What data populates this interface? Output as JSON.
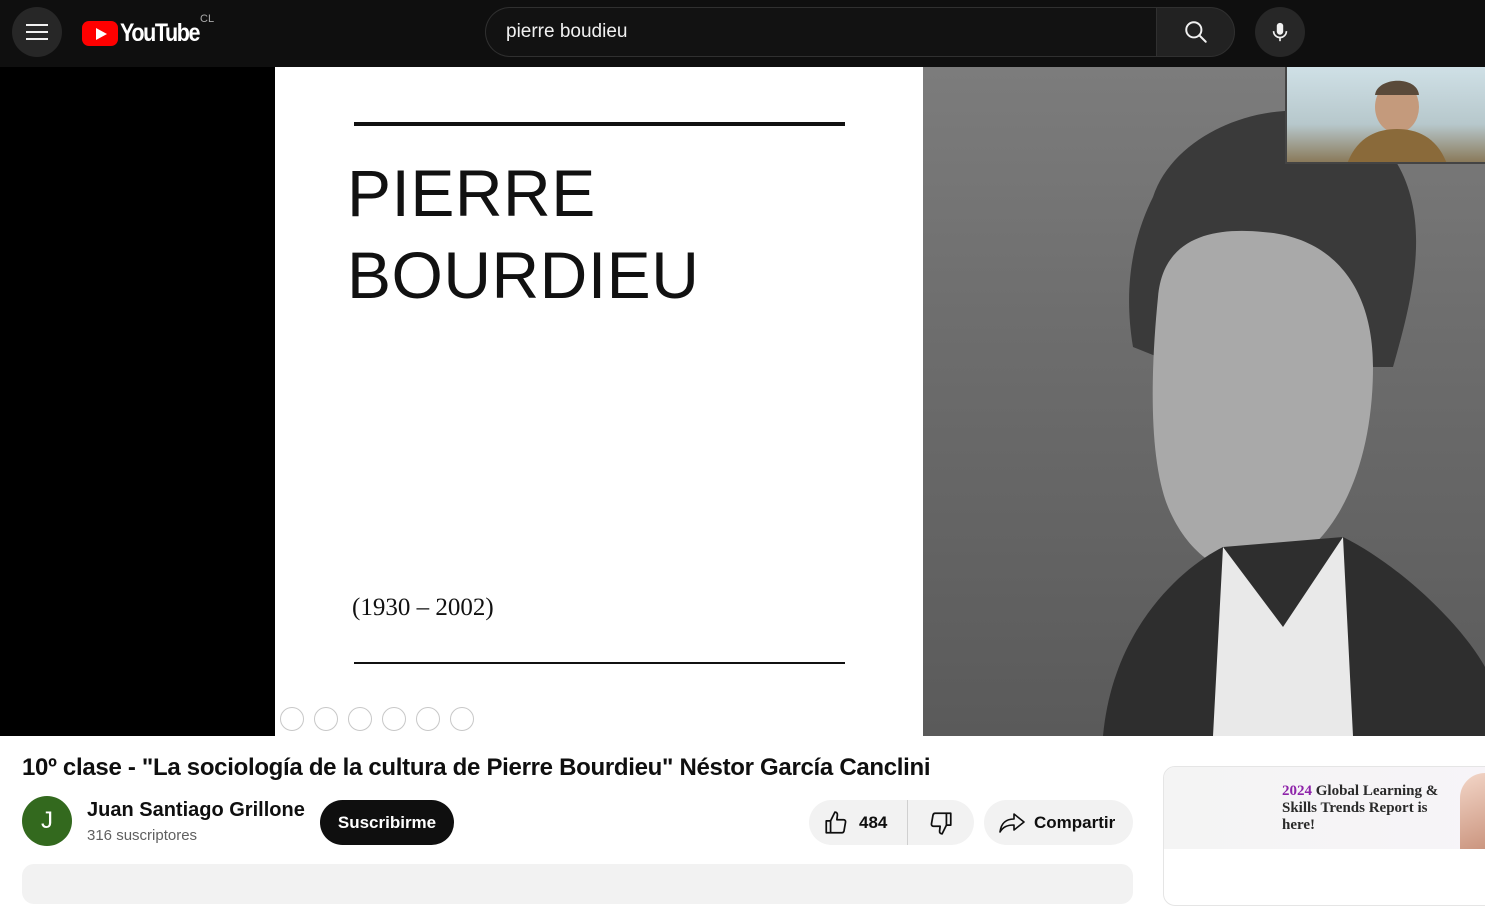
{
  "topbar": {
    "logo_text": "YouTube",
    "country": "CL",
    "search": {
      "value": "pierre boudieu"
    }
  },
  "video": {
    "slide": {
      "title_line1": "PIERRE",
      "title_line2": "BOURDIEU",
      "dates": "(1930 – 2002)"
    },
    "title": "10º clase - \"La sociología de la cultura de Pierre Bourdieu\" Néstor García Canclini"
  },
  "channel": {
    "avatar_letter": "J",
    "name": "Juan Santiago Grillone",
    "subscribers": "316 suscriptores",
    "subscribe_label": "Suscribirme"
  },
  "actions": {
    "like_count": "484",
    "share_label": "Compartir"
  },
  "ad": {
    "year": "2024",
    "headline_rest": "Global Learning & Skills Trends Report is here!"
  },
  "colors": {
    "topbar_bg": "#0f0f0f",
    "brand_red": "#ff0000",
    "channel_avatar": "#33691e",
    "ad_accent": "#8e24aa"
  }
}
